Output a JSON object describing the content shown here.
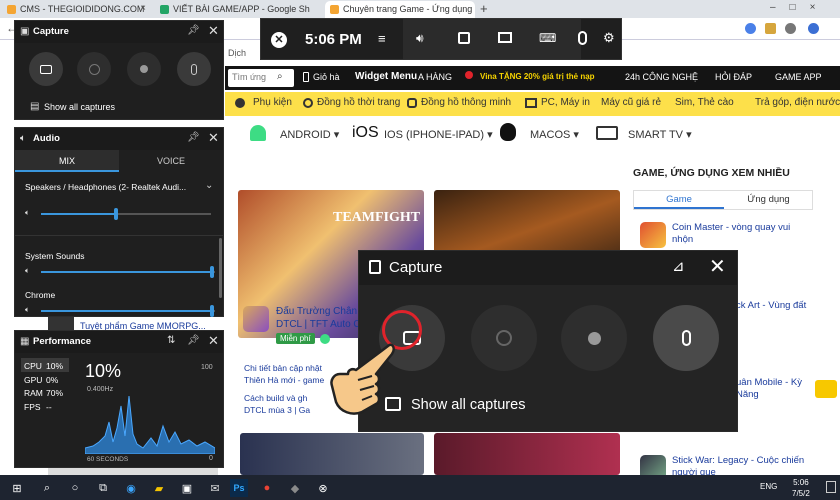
{
  "browser": {
    "tabs": [
      {
        "title": "CMS - THEGIOIDIDONG.COM",
        "color": "#f4a533"
      },
      {
        "title": "VIẾT BÀI GAME/APP - Google Sh",
        "color": "#23a566"
      },
      {
        "title": "Chuyên trang Game - Ứng dụng",
        "color": "#f4a533"
      }
    ],
    "new_tab": "+"
  },
  "site": {
    "dich_label": "Dịch",
    "search_placeholder": "Tìm ứng",
    "nav": [
      "Giỏ hà",
      "Widget Menu",
      "A HÀNG",
      "Vina TẶNG 20% giá trị thẻ nạp",
      "24h CÔNG NGHỆ",
      "HỎI ĐÁP",
      "GAME APP"
    ],
    "categories": [
      "Phụ kiện",
      "Đồng hồ thời trang",
      "Đồng hồ thông minh",
      "PC, Máy in",
      "Máy cũ giá rẻ",
      "Sim, Thẻ cào",
      "Trả góp, điện nước"
    ],
    "os_links": [
      "ANDROID",
      "iOS",
      "IOS (IPHONE-IPAD)",
      "MACOS",
      "SMART TV"
    ],
    "sidebar_title": "GAME, ỨNG DỤNG XEM NHIỀU",
    "sidebar_tabs": [
      "Game",
      "Ứng dụng"
    ],
    "sidebar_items": [
      "Coin Master - vòng quay vui nhộn",
      "ck Art - Vùng đất",
      "uân Mobile - Kỳ Năng",
      "Stick War: Legacy - Cuộc chiến người que"
    ],
    "feat1_title": "Đấu Trường Chân",
    "feat1_sub": "DTCL | TFT Auto C",
    "feat1_badge": "Miễn phí",
    "feat1_links": [
      "Chi tiết bản cập nhật",
      "Thiên Hà mới - game",
      "Cách build và gh",
      "DTCL mùa 3 | Ga"
    ],
    "hero_text": "TEAMFIGHT",
    "left_text": "Tuyệt phẩm Game MMORPG..."
  },
  "gamebar": {
    "time": "5:06 PM",
    "capture_small": {
      "title": "Capture",
      "show_all": "Show all captures"
    },
    "audio": {
      "title": "Audio",
      "tabs": [
        "MIX",
        "VOICE"
      ],
      "device": "Speakers / Headphones (2- Realtek Audi...",
      "master_level": 0.44,
      "apps": [
        {
          "name": "System Sounds",
          "level": 0.98
        },
        {
          "name": "Chrome",
          "level": 0.98
        }
      ]
    },
    "performance": {
      "title": "Performance",
      "stats": [
        {
          "k": "CPU",
          "v": "10%"
        },
        {
          "k": "GPU",
          "v": "0%"
        },
        {
          "k": "RAM",
          "v": "70%"
        },
        {
          "k": "FPS",
          "v": "--"
        }
      ],
      "big_value": "10%",
      "freq": "0.400Hz",
      "max": "100",
      "min": "0",
      "span": "60 SECONDS"
    },
    "capture_big": {
      "title": "Capture",
      "show_all": "Show all captures"
    }
  },
  "taskbar": {
    "time": "5:06",
    "date": "7/5/2",
    "lang": "ENG"
  },
  "colors": {
    "accent": "#3a96dd",
    "highlight": "#e0232b",
    "site_yellow": "#fde04a",
    "nav_black": "#141414"
  }
}
